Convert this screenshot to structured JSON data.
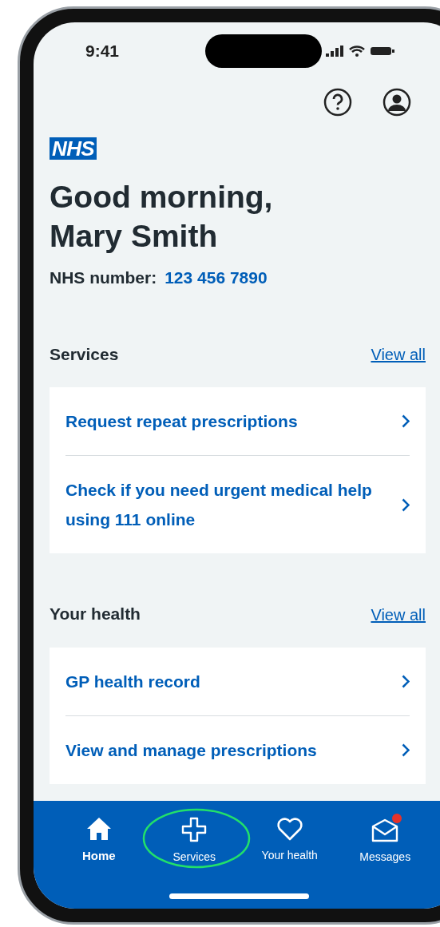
{
  "status_bar": {
    "time": "9:41"
  },
  "logo": "NHS",
  "greeting": {
    "line1": "Good morning,",
    "line2": "Mary Smith"
  },
  "nhs_number": {
    "label": "NHS number:",
    "value": "123 456 7890"
  },
  "sections": [
    {
      "title": "Services",
      "link": "View all",
      "items": [
        {
          "label": "Request repeat prescriptions"
        },
        {
          "label": "Check if you need urgent medical help using 111 online"
        }
      ]
    },
    {
      "title": "Your health",
      "link": "View all",
      "items": [
        {
          "label": "GP health record"
        },
        {
          "label": "View and manage prescriptions"
        }
      ]
    }
  ],
  "nav": [
    {
      "kind": "home",
      "label": "Home",
      "selected": true,
      "badge": false
    },
    {
      "kind": "cross",
      "label": "Services",
      "selected": false,
      "badge": false
    },
    {
      "kind": "heart",
      "label": "Your health",
      "selected": false,
      "badge": false
    },
    {
      "kind": "mail",
      "label": "Messages",
      "selected": false,
      "badge": true
    }
  ]
}
